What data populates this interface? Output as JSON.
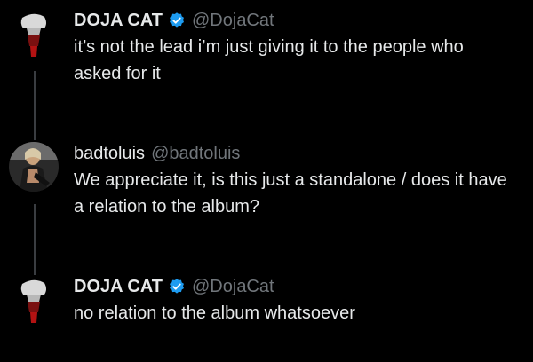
{
  "tweets": [
    {
      "display_name": "DOJA CAT",
      "verified": true,
      "handle": "@DojaCat",
      "text": "it’s not the lead i’m just giving it to the people who asked for it"
    },
    {
      "display_name": "badtoluis",
      "verified": false,
      "handle": "@badtoluis",
      "text": "We appreciate it, is this just a standalone / does it have a relation to the album?"
    },
    {
      "display_name": "DOJA CAT",
      "verified": true,
      "handle": "@DojaCat",
      "text": "no relation to the album whatsoever"
    }
  ],
  "colors": {
    "background": "#000000",
    "text": "#e7e9ea",
    "handle": "#71767b",
    "verified_badge": "#1d9bf0",
    "thread_line": "#3a3d41"
  }
}
